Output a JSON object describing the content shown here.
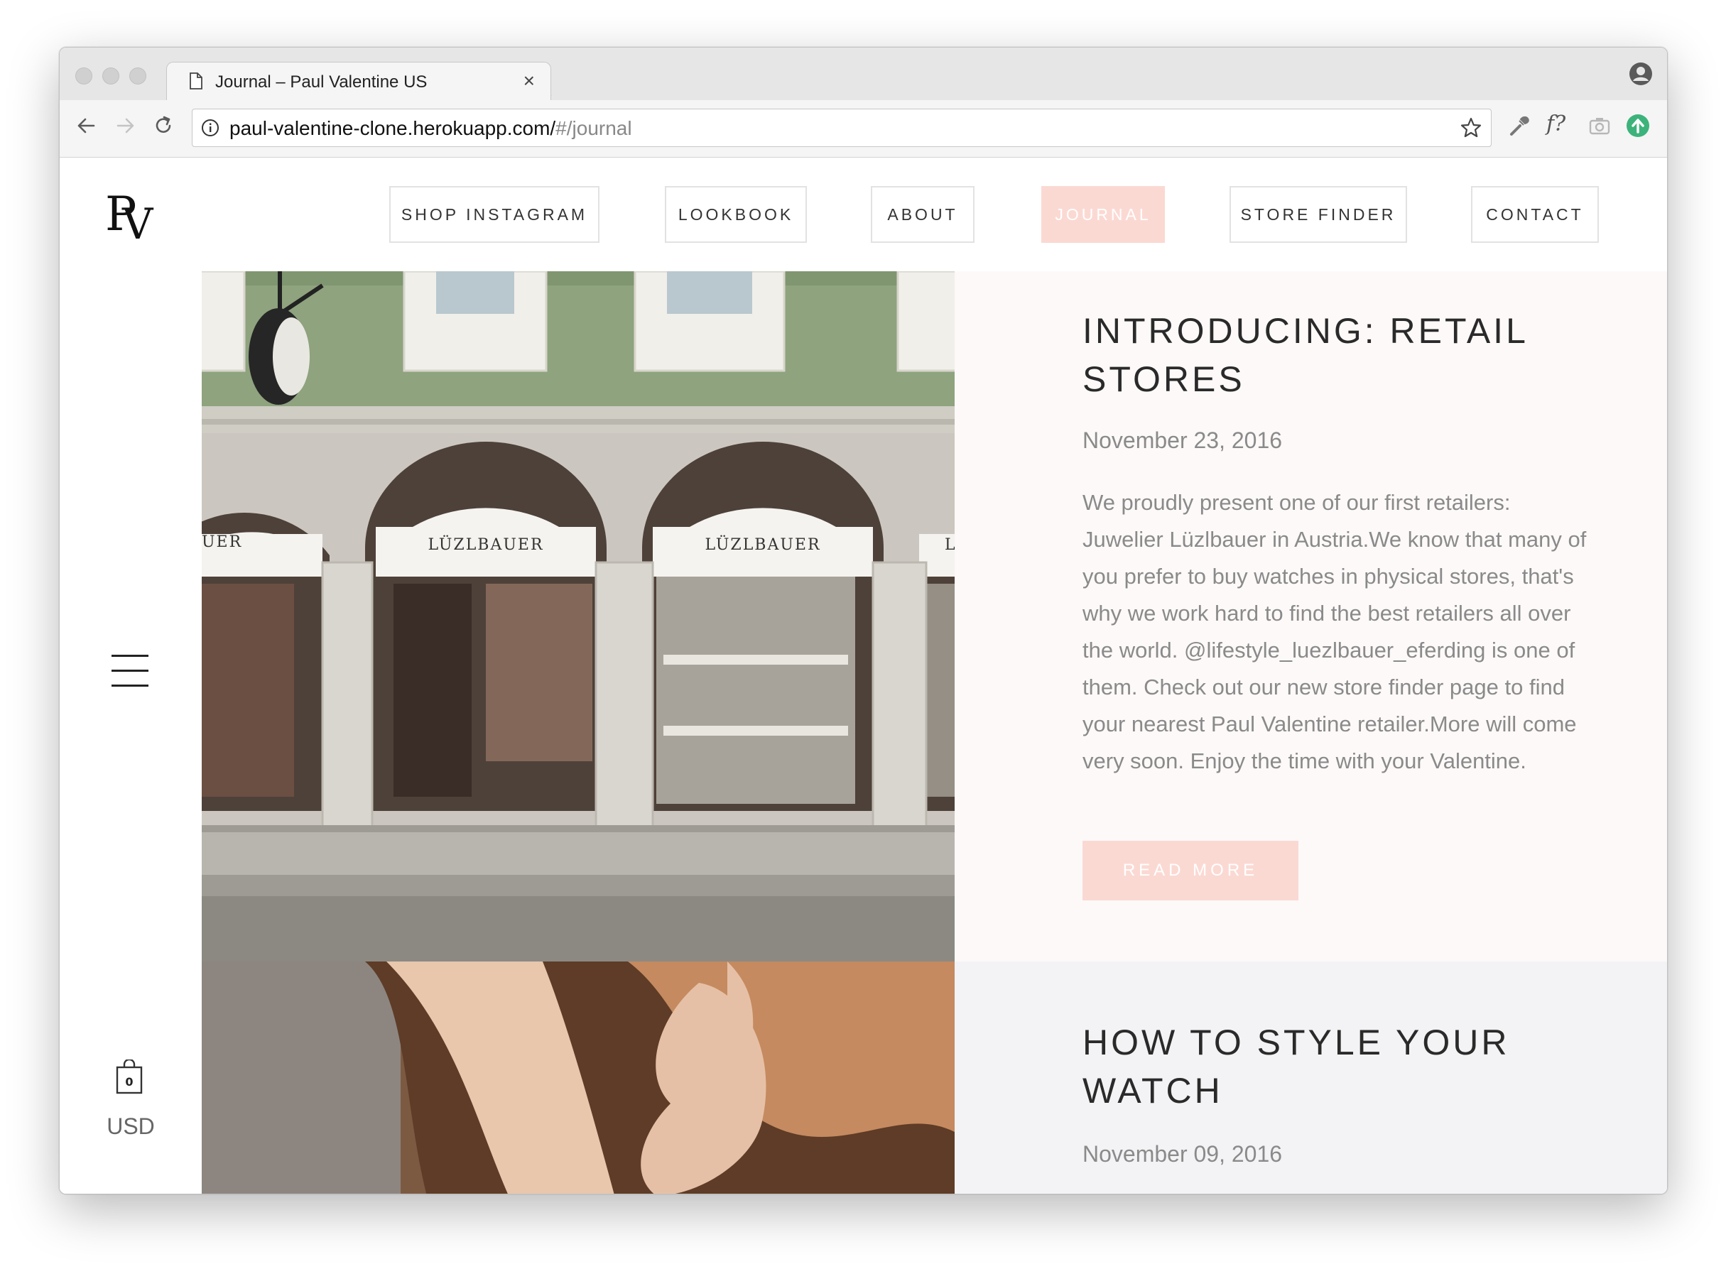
{
  "browser": {
    "tab_title": "Journal – Paul Valentine US",
    "tab_close": "×",
    "url_host": "paul-valentine-clone.herokuapp.com/",
    "url_path": "#/journal",
    "icons": [
      "page-icon",
      "back-icon",
      "forward-icon",
      "reload-icon",
      "info-icon",
      "star-icon",
      "eyedropper-icon",
      "camera-icon",
      "upload-icon",
      "profile-icon"
    ],
    "ext_whatfont_label": "f?"
  },
  "sidebar": {
    "logo": "PV",
    "cart_count": "0",
    "currency": "USD"
  },
  "nav": {
    "items": [
      {
        "label": "SHOP INSTAGRAM"
      },
      {
        "label": "LOOKBOOK"
      },
      {
        "label": "ABOUT"
      },
      {
        "label": "JOURNAL"
      },
      {
        "label": "STORE FINDER"
      },
      {
        "label": "CONTACT"
      }
    ],
    "active_index": 3
  },
  "posts": [
    {
      "title": "INTRODUCING: RETAIL STORES",
      "date": "November 23, 2016",
      "excerpt": "We proudly present one of our first retailers: Juwelier Lüzlbauer in Austria.We know that many of you prefer to buy watches in physical stores, that's why we work hard to find the best retailers all over the world. @lifestyle_luezlbauer_eferding is one of them. Check out our new store finder page to find your nearest Paul Valentine retailer.More will come very soon. Enjoy the time with your Valentine.",
      "read_more": "READ MORE",
      "image": {
        "sign_left": "UER",
        "sign_center": "LÜZLBAUER",
        "sign_center2": "LÜZLBAUER",
        "sign_right": "L"
      }
    },
    {
      "title": "HOW TO STYLE YOUR WATCH",
      "date": "November 09, 2016"
    }
  ],
  "colors": {
    "accent": "#fbd9d3",
    "post1_bg": "#fdf9f8",
    "post2_bg": "#f3f3f5",
    "text_dark": "#2a2a2a",
    "text_muted": "#8a8a8a"
  }
}
